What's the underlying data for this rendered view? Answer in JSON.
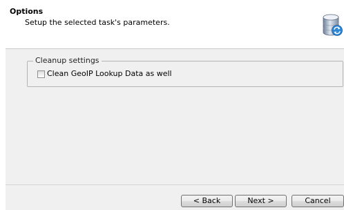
{
  "header": {
    "title": "Options",
    "subtitle": "Setup the selected task's parameters.",
    "icon": "database-sync-icon"
  },
  "cleanup_group": {
    "legend": "Cleanup settings",
    "geoip_checkbox": {
      "label": "Clean GeoIP Lookup Data as well",
      "checked": false
    }
  },
  "buttons": {
    "back": "< Back",
    "next": "Next >",
    "cancel": "Cancel"
  }
}
